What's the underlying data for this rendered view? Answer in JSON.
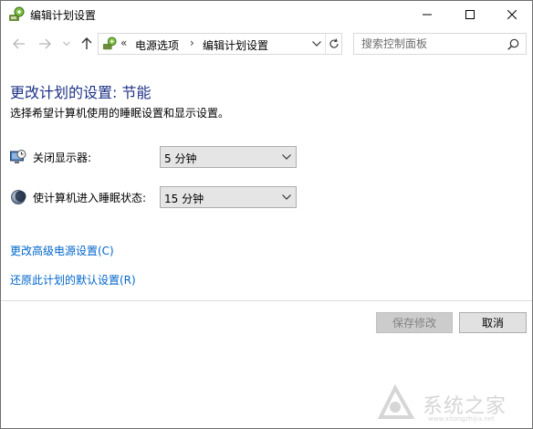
{
  "window": {
    "title": "编辑计划设置",
    "icon": "power-options-icon"
  },
  "nav": {
    "back_icon": "arrow-left-icon",
    "forward_icon": "arrow-right-icon",
    "recent_icon": "chevron-down-icon",
    "up_icon": "arrow-up-icon",
    "overflow": "«",
    "breadcrumbs": [
      "电源选项",
      "编辑计划设置"
    ],
    "refresh_icon": "refresh-icon",
    "search_placeholder": "搜索控制面板"
  },
  "main": {
    "heading": "更改计划的设置: 节能",
    "subtext": "选择希望计算机使用的睡眠设置和显示设置。",
    "settings": [
      {
        "label": "关闭显示器:",
        "value": "5 分钟",
        "icon": "monitor-clock-icon"
      },
      {
        "label": "使计算机进入睡眠状态:",
        "value": "15 分钟",
        "icon": "moon-icon"
      }
    ],
    "links": {
      "advanced": "更改高级电源设置(C)",
      "restore": "还原此计划的默认设置(R)"
    }
  },
  "footer": {
    "save_label": "保存修改",
    "cancel_label": "取消"
  },
  "watermark": {
    "text": "系统之家",
    "url": "www.xitongzhijia.net"
  },
  "colors": {
    "heading": "#1e3287",
    "link": "#0066cc",
    "disabled_text": "#838383"
  }
}
